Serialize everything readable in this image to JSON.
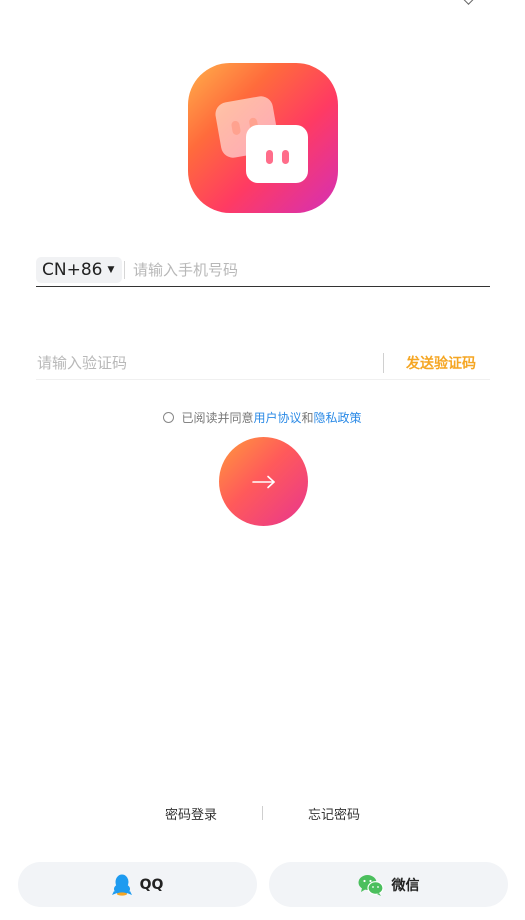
{
  "login": {
    "country_code": "CN+86",
    "phone_placeholder": "请输入手机号码",
    "phone_value": "",
    "code_placeholder": "请输入验证码",
    "code_value": "",
    "send_code_label": "发送验证码"
  },
  "agreement": {
    "prefix": "已阅读并同意",
    "user_agreement": "用户协议",
    "conjunction": "和",
    "privacy_policy": "隐私政策",
    "checked": false
  },
  "submit": {
    "arrow": "→"
  },
  "links": {
    "password_login": "密码登录",
    "forgot_password": "忘记密码"
  },
  "social": {
    "qq_label": "QQ",
    "wechat_label": "微信"
  },
  "colors": {
    "accent_orange": "#f5a623",
    "link_blue": "#2b8ae6",
    "qq_blue": "#1e9bf0",
    "wechat_green": "#4bbf5d"
  }
}
